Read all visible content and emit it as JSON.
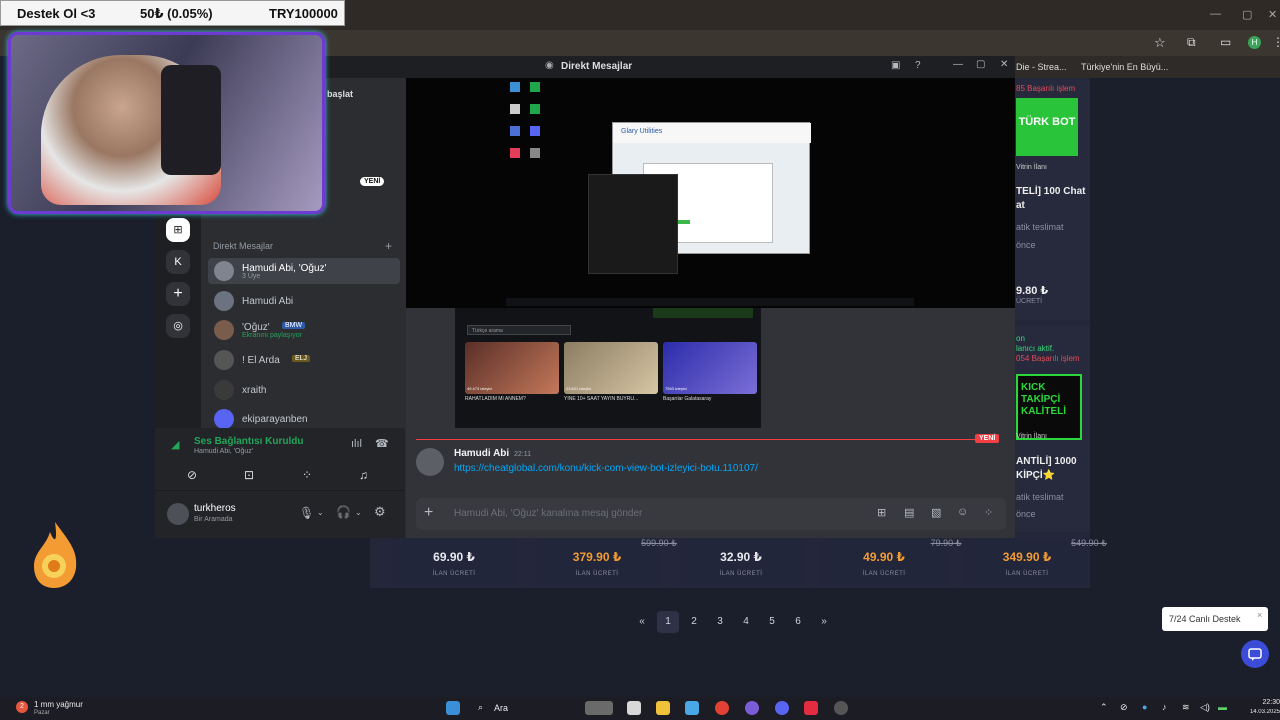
{
  "stream_overlay": {
    "goal_label": "Destek Ol <3",
    "goal_progress": "50₺ (0.05%)",
    "goal_target": "TRY100000"
  },
  "browser": {
    "bookmarks": [
      "Die - Strea...",
      "Türkiye'nin En Büyü..."
    ]
  },
  "discord": {
    "window_title": "Direkt Mesajlar",
    "partial_label": "başlat",
    "new_badge": "YENİ",
    "servers": [
      "K"
    ],
    "dm_header": "Direkt Mesajlar",
    "dms": [
      {
        "name": "Hamudi Abi, 'Oğuz'",
        "sub": "3 Üye"
      },
      {
        "name": "Hamudi Abi",
        "sub": ""
      },
      {
        "name": "'Oğuz'",
        "badge": "BMW",
        "sub": "Ekranını paylaşıyor"
      },
      {
        "name": "! El Arda",
        "badge": "ELJ",
        "sub": ""
      },
      {
        "name": "xraith",
        "sub": ""
      },
      {
        "name": "ekiparayanben",
        "sub": ""
      }
    ],
    "voice": {
      "status": "Ses Bağlantısı Kuruldu",
      "channel": "Hamudi Abi, 'Oğuz'"
    },
    "user": {
      "name": "turkheros",
      "status": "Bir Aramada"
    },
    "screen_share": {
      "app_title": "Glary Utilities",
      "search_placeholder": "Türkçe arama",
      "streams": [
        {
          "title": "RAHATLADIM MI ANNEM?",
          "viewers": "49.473 izleyici"
        },
        {
          "title": "YİNE 10+ SAAT YAYIN BUYRU...",
          "viewers": "23.621 izleyici"
        },
        {
          "title": "Başarılar Galatasaray",
          "viewers": "7553 izleyici"
        }
      ]
    },
    "new_divider": "YENİ",
    "message": {
      "author": "Hamudi Abi",
      "time": "22:11",
      "link": "https://cheatglobal.com/konu/kick-com-view-bot-izleyici-botu.110107/"
    },
    "input_placeholder": "Hamudi Abi, 'Oğuz' kanalına mesaj gönder"
  },
  "site": {
    "right_cards": [
      {
        "sales": "85 Başarılı işlem",
        "banner": "TÜRK BOT",
        "vitrin": "Vitrin İlanı",
        "title": "TELİ] 100 Chat",
        "title2": "at",
        "delivery": "atik teslimat",
        "ago": "önce",
        "price": "9.80 ₺",
        "price_label": "ÜCRETİ"
      },
      {
        "sales_head": "on",
        "sales_line": "lanıcı aktif.",
        "sales": "054 Başarılı işlem",
        "banner": "KICK TAKİPÇİ KALİTELİ",
        "vitrin": "Vitrin İlanı",
        "title": "ANTİLİ] 1000",
        "title2": "KİPÇİ⭐",
        "delivery": "atik teslimat",
        "ago": "önce"
      }
    ],
    "bottom_cards": [
      {
        "price": "69.90 ₺",
        "old": "",
        "label": "İLAN ÜCRETİ",
        "accent": false
      },
      {
        "price": "379.90 ₺",
        "old": "599.90 ₺",
        "label": "İLAN ÜCRETİ",
        "accent": true
      },
      {
        "price": "32.90 ₺",
        "old": "",
        "label": "İLAN ÜCRETİ",
        "accent": false
      },
      {
        "price": "49.90 ₺",
        "old": "79.90 ₺",
        "label": "İLAN ÜCRETİ",
        "accent": true
      },
      {
        "price": "349.90 ₺",
        "old": "549.90 ₺",
        "label": "İLAN ÜCRETİ",
        "accent": true
      }
    ],
    "pagination": [
      "«",
      "1",
      "2",
      "3",
      "4",
      "5",
      "6",
      "»"
    ],
    "active_page": "1",
    "support_label": "7/24 Canlı Destek"
  },
  "taskbar": {
    "weather": "1 mm yağmur",
    "weather_sub": "Pazar",
    "weather_badge": "2",
    "search": "Ara",
    "time": "22:30",
    "date": "14.03.2025"
  },
  "colors": {
    "discord_accent": "#5865f2",
    "online": "#23a55a",
    "danger": "#f23f43",
    "price_accent": "#f39c34"
  }
}
